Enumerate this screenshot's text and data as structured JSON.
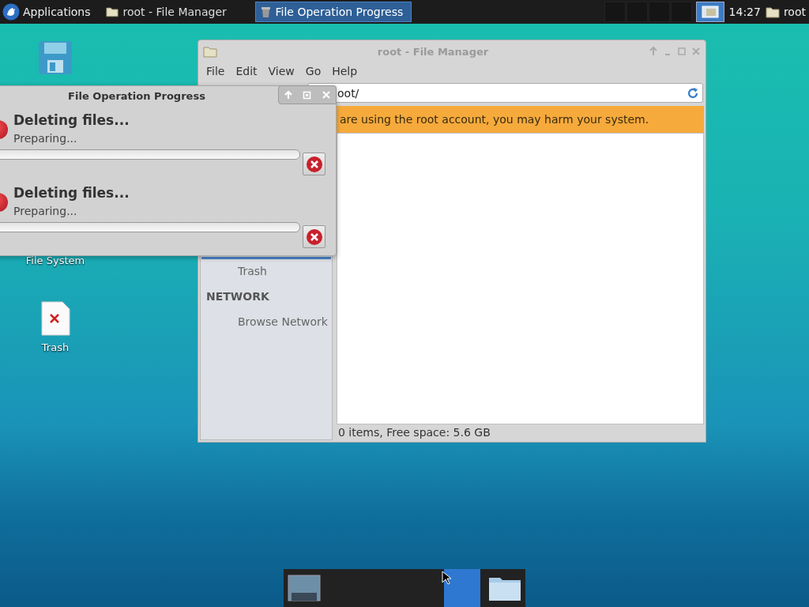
{
  "panel": {
    "menu_label": "Applications",
    "tasks": [
      {
        "title": "root - File Manager",
        "selected": false
      },
      {
        "title": "File Operation Progress",
        "selected": true
      }
    ],
    "workspaces": [
      {
        "selected": false
      },
      {
        "selected": false
      },
      {
        "selected": false
      },
      {
        "selected": false
      },
      {
        "selected": true
      }
    ],
    "clock": "14:27",
    "user": "root"
  },
  "desktop_icons": [
    {
      "kind": "floppy"
    },
    {
      "kind": "hidden",
      "label": "File System"
    },
    {
      "kind": "trash",
      "label": "Trash"
    }
  ],
  "file_manager": {
    "title": "root - File Manager",
    "menu": [
      "File",
      "Edit",
      "View",
      "Go",
      "Help"
    ],
    "location": "oot/",
    "banner": "are using the root account, you may harm your system.",
    "sidebar": [
      {
        "kind": "item",
        "label": "Trash"
      },
      {
        "kind": "heading",
        "label": "NETWORK"
      },
      {
        "kind": "item",
        "label": "Browse Network"
      }
    ],
    "status": "0 items, Free space: 5.6 GB"
  },
  "dialog": {
    "title": "File Operation Progress",
    "operations": [
      {
        "title": "Deleting files...",
        "status": "Preparing...",
        "level": 0
      },
      {
        "title": "Deleting files...",
        "status": "Preparing...",
        "level": 0
      }
    ]
  },
  "dock": [
    {
      "kind": "monitor",
      "selected": false
    },
    {
      "kind": "blank",
      "selected": true
    },
    {
      "kind": "folder",
      "selected": false
    }
  ]
}
